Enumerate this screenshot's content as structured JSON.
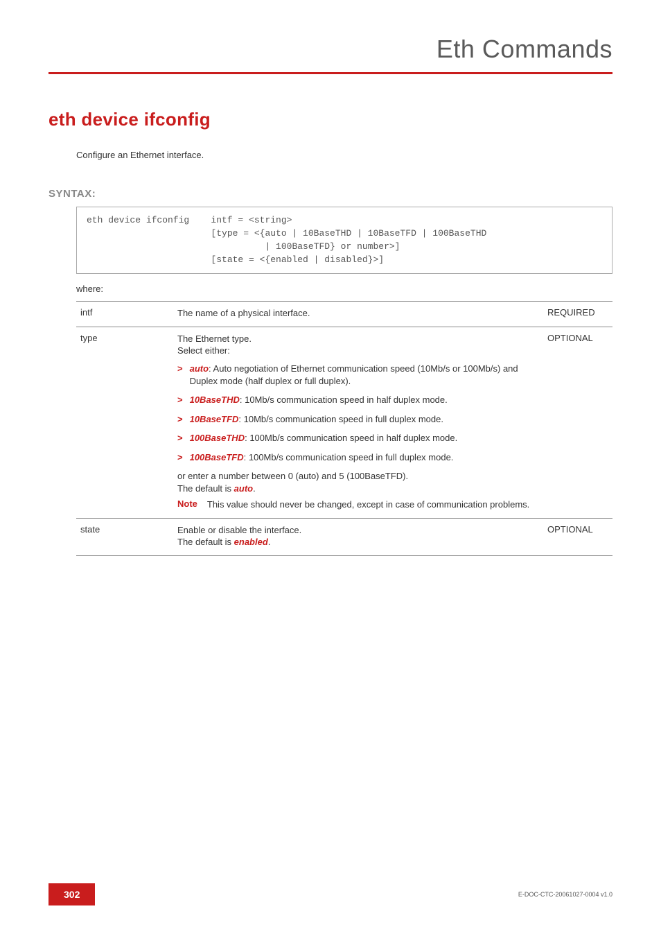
{
  "header": {
    "title": "Eth Commands"
  },
  "command": {
    "title": "eth device ifconfig",
    "intro": "Configure an Ethernet interface."
  },
  "syntax": {
    "label": "SYNTAX:",
    "code": "eth device ifconfig    intf = <string>\n                       [type = <{auto | 10BaseTHD | 10BaseTFD | 100BaseTHD\n                                 | 100BaseTFD} or number>]\n                       [state = <{enabled | disabled}>]",
    "where": "where:"
  },
  "params": [
    {
      "name": "intf",
      "desc_lead": "The name of a physical interface.",
      "flag": "REQUIRED"
    },
    {
      "name": "type",
      "desc_lead": "The Ethernet type.\nSelect either:",
      "flag": "OPTIONAL",
      "bullets": [
        {
          "term": "auto",
          "text": ": Auto negotiation of Ethernet communication speed (10Mb/s or 100Mb/s) and Duplex mode (half duplex or full duplex)."
        },
        {
          "term": "10BaseTHD",
          "text": ": 10Mb/s communication speed in half duplex mode."
        },
        {
          "term": "10BaseTFD",
          "text": ": 10Mb/s communication speed in full duplex mode."
        },
        {
          "term": "100BaseTHD",
          "text": ": 100Mb/s communication speed in half duplex mode."
        },
        {
          "term": "100BaseTFD",
          "text": ": 100Mb/s communication speed in full duplex mode."
        }
      ],
      "trailer_pre": "or enter a number between 0 (auto) and 5 (100BaseTFD).\nThe default is ",
      "trailer_term": "auto",
      "trailer_post": ".",
      "note": {
        "label": "Note",
        "text": "This value should never be changed, except in case of communication problems."
      }
    },
    {
      "name": "state",
      "desc_lead": "Enable or disable the interface.\nThe default is ",
      "desc_term": "enabled",
      "desc_post": ".",
      "flag": "OPTIONAL"
    }
  ],
  "footer": {
    "page": "302",
    "docid": "E-DOC-CTC-20061027-0004 v1.0"
  }
}
